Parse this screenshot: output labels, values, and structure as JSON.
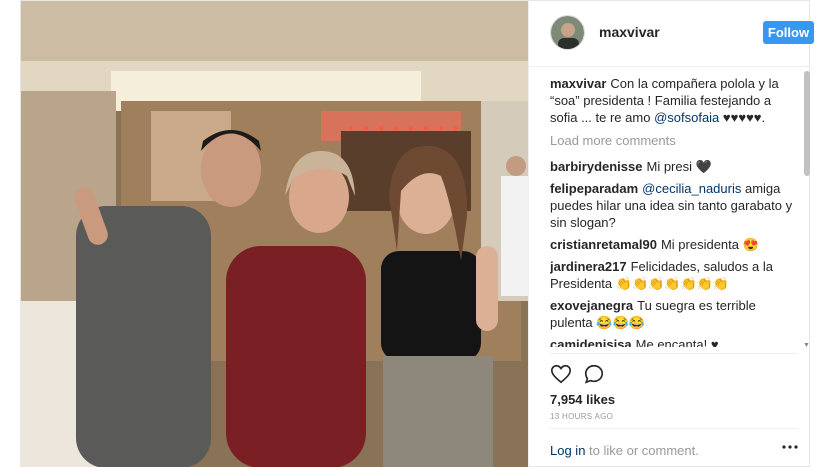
{
  "post": {
    "username": "maxvivar",
    "follow_label": "Follow",
    "caption_user": "maxvivar",
    "caption_text": "Con la compañera polola y la “soa” presidenta ! Familia festejando a sofia ... te re amo",
    "caption_mention": "@sofsofaia",
    "caption_hearts": "♥♥♥♥♥.",
    "load_more": "Load more comments",
    "comments": [
      {
        "user": "barbirydenisse",
        "text": "Mi presi 🖤"
      },
      {
        "user": "felipeparadam",
        "mention": "@cecilia_naduris",
        "text": "amiga puedes hilar una idea sin tanto garabato y sin slogan?"
      },
      {
        "user": "cristianretamal90",
        "text": "Mi presidenta 😍"
      },
      {
        "user": "jardinera217",
        "text": "Felicidades, saludos a la Presidenta 👏👏👏👏👏👏👏"
      },
      {
        "user": "exovejanegra",
        "text": "Tu suegra es terrible pulenta 😂😂😂"
      },
      {
        "user": "camidenisisa",
        "text": "Me encanta! ♥ extrañaremos nuestra presi😍😍"
      }
    ],
    "likes": "7,954 likes",
    "time": "13 HOURS AGO",
    "login_link": "Log in",
    "login_rest": "to like or comment."
  },
  "icons": {
    "heart": "heart-icon",
    "comment": "comment-icon",
    "more": "more-icon"
  },
  "colors": {
    "follow_bg": "#3897f0",
    "link": "#003569",
    "muted": "#999999"
  }
}
